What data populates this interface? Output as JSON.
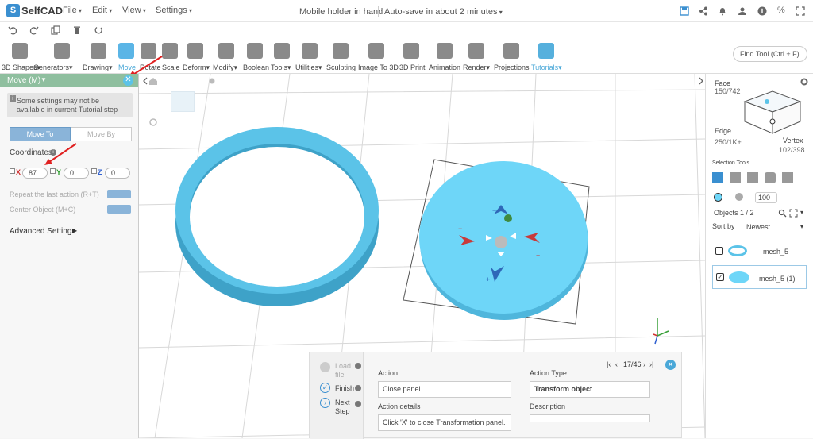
{
  "app": {
    "logo": "SelfCAD",
    "project_title": "Mobile holder in hand",
    "autosave": "Auto-save in about 2 minutes"
  },
  "menus": [
    "File",
    "Edit",
    "View",
    "Settings"
  ],
  "toolbar": {
    "tools": [
      "3D Shapes",
      "Generators",
      "Drawing",
      "Move",
      "Rotate",
      "Scale",
      "Deform",
      "Modify",
      "Boolean",
      "Tools",
      "Utilities",
      "Sculpting",
      "Image To 3D",
      "3D Print",
      "Animation",
      "Render",
      "Projections",
      "Tutorials"
    ],
    "find_tool": "Find Tool (Ctrl + F)"
  },
  "move_panel": {
    "title": "Move (M)",
    "notice": "Some settings may not be available in current Tutorial step",
    "tab_move_to": "Move To",
    "tab_move_by": "Move By",
    "coordinates_label": "Coordinates",
    "x_label": "X",
    "y_label": "Y",
    "z_label": "Z",
    "x_value": "87",
    "y_value": "0",
    "z_value": "0",
    "repeat_label": "Repeat the last action (R+T)",
    "center_label": "Center Object (M+C)",
    "advanced_label": "Advanced Settings"
  },
  "view_cube": {
    "face_label": "Face",
    "face_count": "150/742",
    "edge_label": "Edge",
    "edge_count": "250/1K+",
    "vertex_label": "Vertex",
    "vertex_count": "102/398"
  },
  "right_panel": {
    "selection_tools": "Selection Tools",
    "opacity_value": "100",
    "objects_label": "Objects 1 / 2",
    "sort_label": "Sort by",
    "sort_value": "Newest",
    "objects": [
      {
        "name": "mesh_5",
        "checked": false
      },
      {
        "name": "mesh_5 (1)",
        "checked": true
      }
    ]
  },
  "tutorial": {
    "steps": [
      "Load file",
      "Finish",
      "Next Step"
    ],
    "action_label": "Action",
    "action_value": "Close panel",
    "action_details_label": "Action details",
    "action_details_value": "Click 'X' to close Transformation panel.",
    "action_type_label": "Action Type",
    "action_type_value": "Transform object",
    "description_label": "Description",
    "pager": "17/46"
  },
  "colors": {
    "accent": "#4aa8d8",
    "ring": "#5bc3e8",
    "disk": "#6ed6f8",
    "panel_header": "#8fbf9f"
  }
}
